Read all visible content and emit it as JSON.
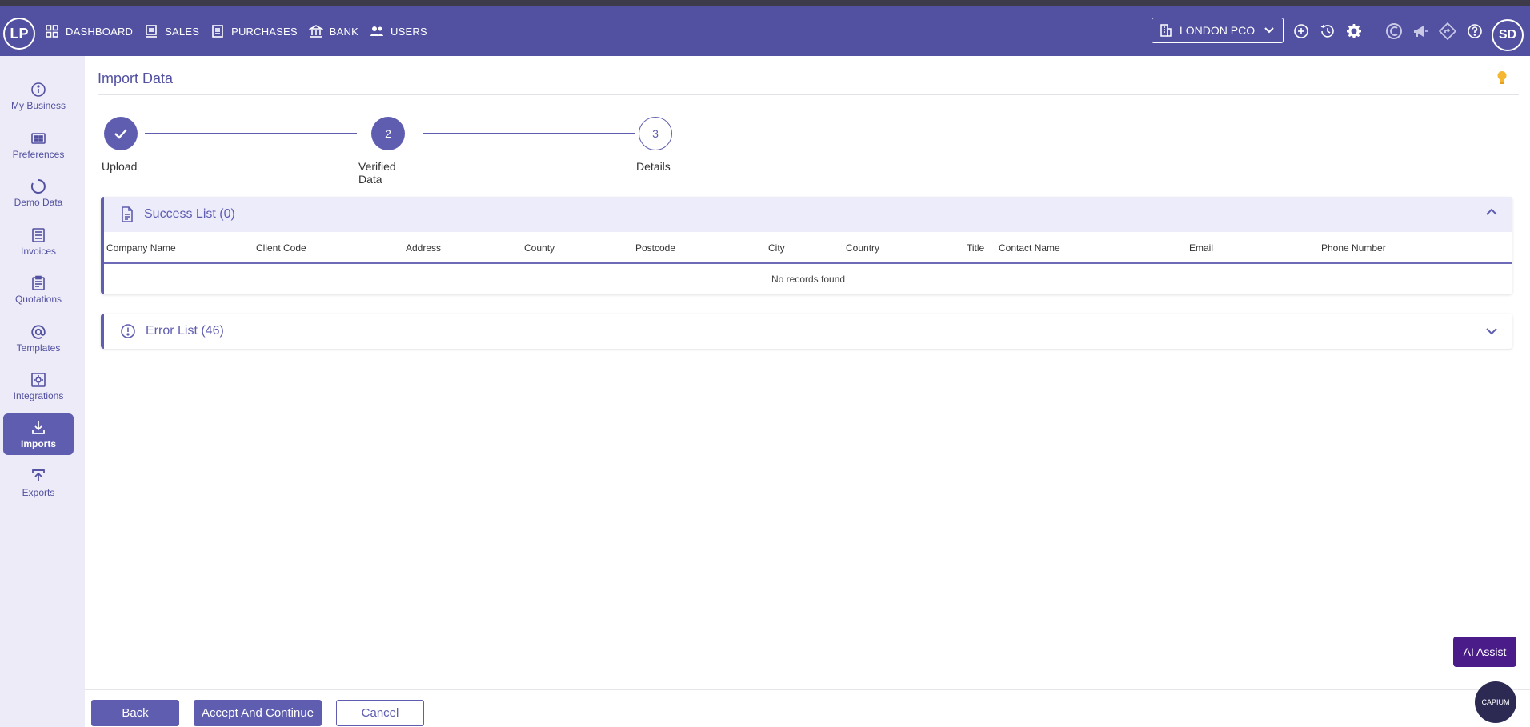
{
  "topbar": {
    "logo": "LP",
    "nav": [
      {
        "label": "DASHBOARD"
      },
      {
        "label": "SALES"
      },
      {
        "label": "PURCHASES"
      },
      {
        "label": "BANK"
      },
      {
        "label": "USERS"
      }
    ],
    "company": "LONDON PCO",
    "user_initials": "SD"
  },
  "sidebar": {
    "items": [
      {
        "label": "My Business"
      },
      {
        "label": "Preferences"
      },
      {
        "label": "Demo Data"
      },
      {
        "label": "Invoices"
      },
      {
        "label": "Quotations"
      },
      {
        "label": "Templates"
      },
      {
        "label": "Integrations"
      },
      {
        "label": "Imports"
      },
      {
        "label": "Exports"
      }
    ],
    "active": "Imports"
  },
  "page": {
    "title": "Import Data"
  },
  "stepper": {
    "steps": [
      {
        "label": "Upload",
        "number": "",
        "state": "done"
      },
      {
        "label": "Verified Data",
        "number": "2",
        "state": "current"
      },
      {
        "label": "Details",
        "number": "3",
        "state": "next"
      }
    ]
  },
  "success_panel": {
    "title": "Success List (0)",
    "columns": [
      "Company Name",
      "Client Code",
      "Address",
      "County",
      "Postcode",
      "City",
      "Country",
      "Title",
      "Contact Name",
      "Email",
      "Phone Number"
    ],
    "empty_text": "No records found"
  },
  "error_panel": {
    "title": "Error List (46)"
  },
  "ai_assist": "AI Assist",
  "buttons": {
    "back": "Back",
    "accept": "Accept And Continue",
    "cancel": "Cancel"
  },
  "capium_badge": "CAPIUM",
  "colors": {
    "primary": "#5f5db0",
    "topbar": "#5250a0",
    "sidebar_bg": "#ecebf7",
    "ai_assist": "#4a1c8a"
  }
}
